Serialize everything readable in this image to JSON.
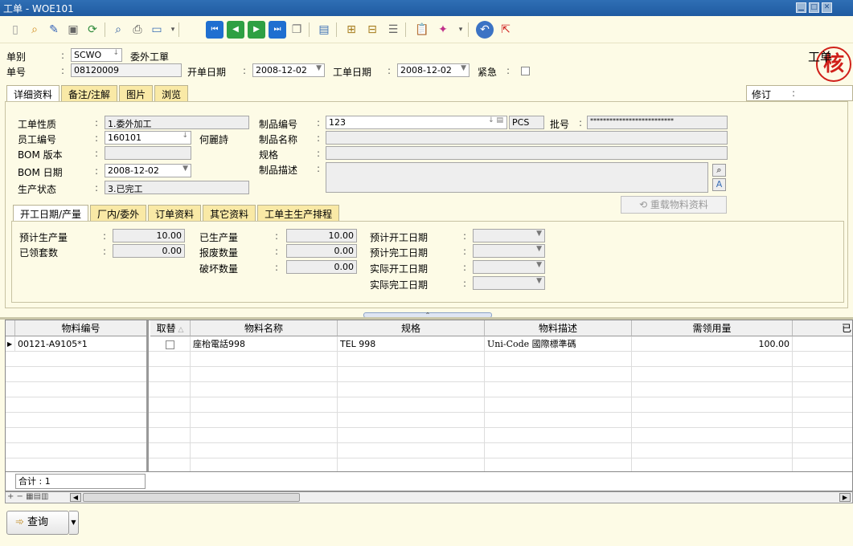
{
  "window": {
    "title": "工单 - WOE101"
  },
  "header": {
    "stamp": "核",
    "corner_label": "工单",
    "type_label": "单别",
    "type_code": "SCWO",
    "type_name": "委外工單",
    "no_label": "单号",
    "no_value": "08120009",
    "open_date_label": "开单日期",
    "open_date_value": "2008-12-02",
    "wo_date_label": "工单日期",
    "wo_date_value": "2008-12-02",
    "urgent_label": "紧急"
  },
  "main_tabs": [
    "详细资料",
    "备注/注解",
    "图片",
    "浏览"
  ],
  "revision_label": "修订",
  "detail": {
    "nature_label": "工单性质",
    "nature_value": "1.委外加工",
    "emp_label": "员工编号",
    "emp_value": "160101",
    "emp_name": "何麗詩",
    "bom_ver_label": "BOM 版本",
    "bom_ver_value": "",
    "bom_date_label": "BOM 日期",
    "bom_date_value": "2008-12-02",
    "status_label": "生产状态",
    "status_value": "3.已完工",
    "prod_no_label": "制品编号",
    "prod_no_value": "123",
    "prod_unit": "PCS",
    "batch_label": "批号",
    "batch_value": "**************************",
    "prod_name_label": "制品名称",
    "prod_name_value": "",
    "spec_label": "规格",
    "spec_value": "",
    "desc_label": "制品描述",
    "desc_value": "",
    "reload_button": "重载物料资料"
  },
  "sub_tabs": [
    "开工日期/产量",
    "厂内/委外",
    "订单资料",
    "其它资料",
    "工单主生产排程"
  ],
  "production": {
    "planned_qty_label": "预计生产量",
    "planned_qty": "10.00",
    "issued_sets_label": "已领套数",
    "issued_sets": "0.00",
    "produced_label": "已生产量",
    "produced": "10.00",
    "scrap_label": "报废数量",
    "scrap": "0.00",
    "damage_label": "破坏数量",
    "damage": "0.00",
    "plan_start_label": "预计开工日期",
    "plan_end_label": "预计完工日期",
    "actual_start_label": "实际开工日期",
    "actual_end_label": "实际完工日期"
  },
  "grid": {
    "columns": [
      "物料编号",
      "取替",
      "物料名称",
      "规格",
      "物料描述",
      "需领用量",
      "已"
    ],
    "rows": [
      {
        "code": "00121-A9105*1",
        "name": "座枱電話998",
        "spec": "TEL 998",
        "desc": "Uni-Code 國際標準碼",
        "qty": "100.00"
      }
    ],
    "total_label": "合计 : 1"
  },
  "footer": {
    "query_button": "查询"
  }
}
